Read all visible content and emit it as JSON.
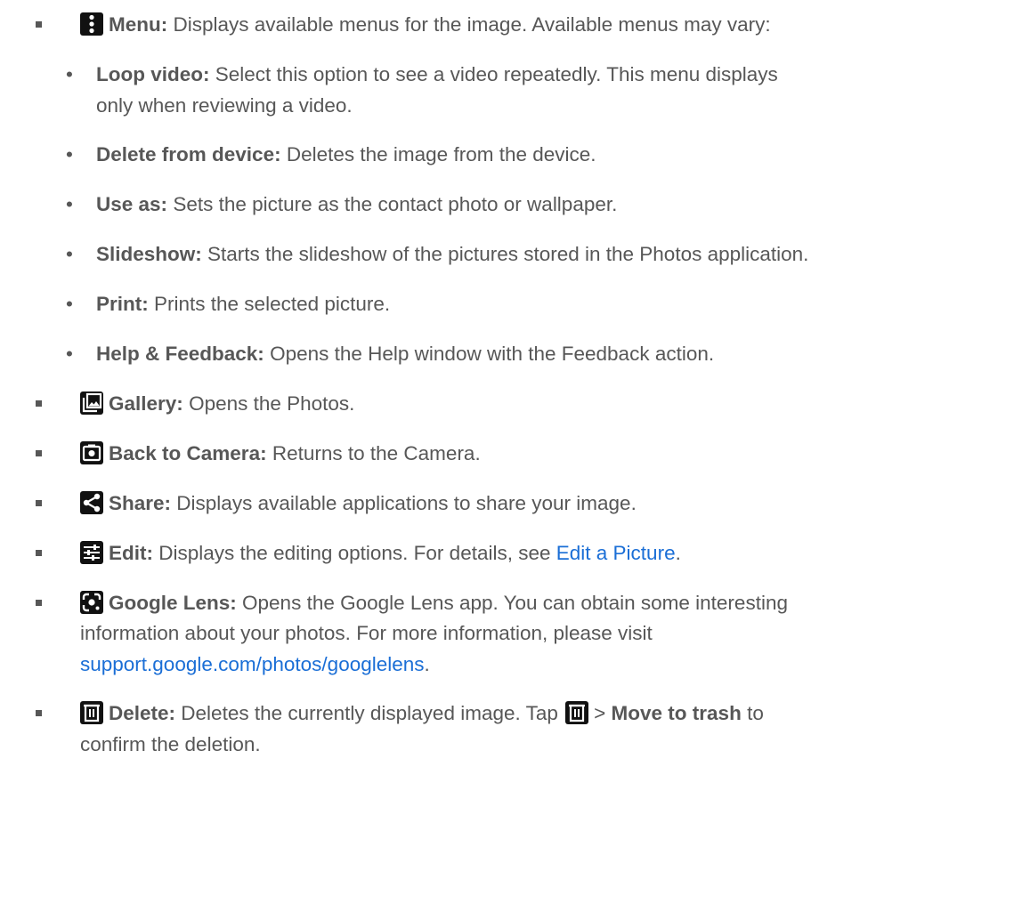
{
  "items": {
    "menu": {
      "label": "Menu:",
      "desc": "Displays available menus for the image. Available menus may vary:"
    },
    "submenus": [
      {
        "label": "Loop video:",
        "desc_line1": "Select this option to see a video repeatedly. This menu displays",
        "desc_line2": "only when reviewing a video."
      },
      {
        "label": "Delete from device:",
        "desc": "Deletes the image from the device."
      },
      {
        "label": "Use as:",
        "desc": "Sets the picture as the contact photo or wallpaper."
      },
      {
        "label": "Slideshow:",
        "desc": "Starts the slideshow of the pictures stored in the Photos application."
      },
      {
        "label": "Print:",
        "desc": "Prints the selected picture."
      },
      {
        "label": "Help & Feedback:",
        "desc": "Opens the Help window with the Feedback action."
      }
    ],
    "gallery": {
      "label": "Gallery:",
      "desc": "Opens the Photos."
    },
    "back_to_camera": {
      "label": "Back to Camera:",
      "desc": "Returns to the Camera."
    },
    "share": {
      "label": "Share:",
      "desc": "Displays available applications to share your image."
    },
    "edit": {
      "label": "Edit:",
      "desc": "Displays the editing options. For details, see",
      "link": "Edit a Picture",
      "after": "."
    },
    "google_lens": {
      "label": "Google Lens:",
      "desc_line1": "Opens the Google Lens app. You can obtain some interesting",
      "desc_line2": "information about your photos. For more information, please visit",
      "link": "support.google.com/photos/googlelens",
      "after": "."
    },
    "delete": {
      "label": "Delete:",
      "desc": "Deletes the currently displayed image. Tap",
      "sep": ">",
      "action": "Move to trash",
      "after": "to",
      "line2": "confirm the deletion."
    }
  },
  "icons": {
    "menu": "more-vert-icon",
    "gallery": "gallery-icon",
    "camera": "camera-icon",
    "share": "share-icon",
    "edit": "tune-icon",
    "lens": "google-lens-icon",
    "delete": "trash-icon"
  },
  "colors": {
    "text": "#575757",
    "link": "#1a6ed6",
    "icon_bg": "#111111"
  }
}
